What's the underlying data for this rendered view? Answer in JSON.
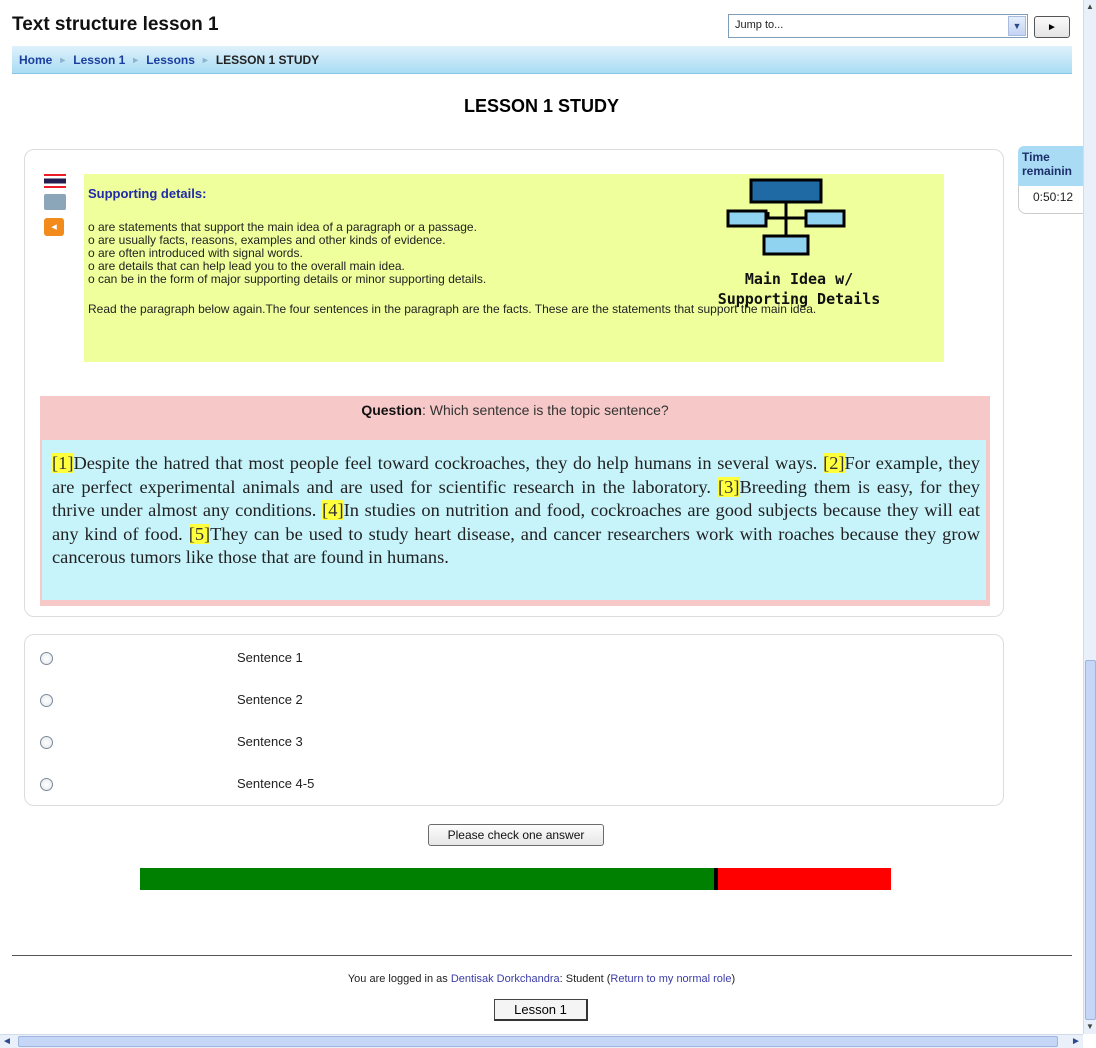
{
  "header": {
    "title": "Text structure lesson 1",
    "jump_to": "Jump to...",
    "go_icon": "play-arrow-icon"
  },
  "breadcrumb": {
    "items": [
      "Home",
      "Lesson 1",
      "Lessons"
    ],
    "current": "LESSON 1 STUDY"
  },
  "page": {
    "heading": "LESSON 1 STUDY"
  },
  "content": {
    "panel_title": "Supporting details:",
    "points": [
      "o are statements that support the main idea of a paragraph or a passage.",
      "o are usually facts, reasons, examples and other kinds of evidence.",
      "o are often introduced with signal words.",
      "o are details that can help lead you to the overall main idea.",
      "o can be in the form of major supporting details or minor supporting details."
    ],
    "instruction": "Read the paragraph below again.The four sentences in the paragraph are the facts. These are the statements that support the main idea.",
    "diagram_caption_1": "Main Idea w/",
    "diagram_caption_2": "Supporting Details",
    "icons": [
      "thai-flag-icon",
      "book-icon",
      "speaker-icon"
    ]
  },
  "question": {
    "label": "Question",
    "text": ": Which sentence is the topic sentence?"
  },
  "passage": {
    "sentences": [
      {
        "num": "[1]",
        "text": "Despite the hatred that most people feel toward cockroaches, they do help humans in several ways. "
      },
      {
        "num": "[2]",
        "text": "For example, they are perfect experimental animals and are used for scientific research in the laboratory. "
      },
      {
        "num": "[3]",
        "text": "Breeding them is easy, for they thrive under almost any conditions. "
      },
      {
        "num": "[4]",
        "text": "In studies on nutrition and food, cockroaches are good subjects because they will eat any kind of food. "
      },
      {
        "num": "[5]",
        "text": "They can be used to study heart disease, and cancer researchers work with roaches because they grow cancerous tumors like those that are found in humans."
      }
    ]
  },
  "answers": {
    "options": [
      "Sentence 1",
      "Sentence 2",
      "Sentence 3",
      "Sentence 4-5"
    ]
  },
  "actions": {
    "check": "Please check one answer"
  },
  "progress": {
    "fraction": 0.767,
    "done_color": "#008000",
    "remaining_color": "#ff0000"
  },
  "timer": {
    "label_line1": "Time",
    "label_line2": "remainin",
    "value": "0:50:12"
  },
  "footer": {
    "prefix": "You are logged in as ",
    "user": "Dentisak Dorkchandra",
    "role": ": Student (",
    "return_link": "Return to my normal role",
    "suffix": ")",
    "lesson_button": "Lesson 1"
  }
}
